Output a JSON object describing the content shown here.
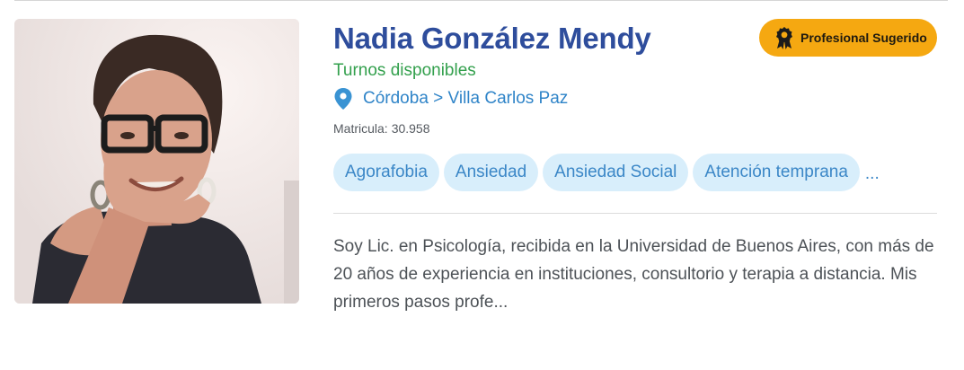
{
  "profile": {
    "name": "Nadia González Mendy",
    "availability": "Turnos disponibles",
    "location": "Córdoba > Villa Carlos Paz",
    "license_label": "Matricula:",
    "license_number": "30.958",
    "photo_alt": "Nadia González Mendy"
  },
  "badge": {
    "label": "Profesional Sugerido"
  },
  "tags": {
    "items": [
      "Agorafobia",
      "Ansiedad",
      "Ansiedad Social",
      "Atención temprana"
    ],
    "more": "..."
  },
  "bio": {
    "text": "Soy Lic. en Psicología, recibida en la Universidad de Buenos Aires, con más de 20 años de experiencia en instituciones, consultorio y terapia a distancia. Mis primeros pasos profe..."
  },
  "colors": {
    "name": "#2e4d9c",
    "availability": "#33a04d",
    "link": "#2f84c8",
    "tag_bg": "#d8eefb",
    "badge_bg": "#f5a811"
  },
  "icons": {
    "location": "map-pin-icon",
    "badge": "award-ribbon-icon"
  }
}
